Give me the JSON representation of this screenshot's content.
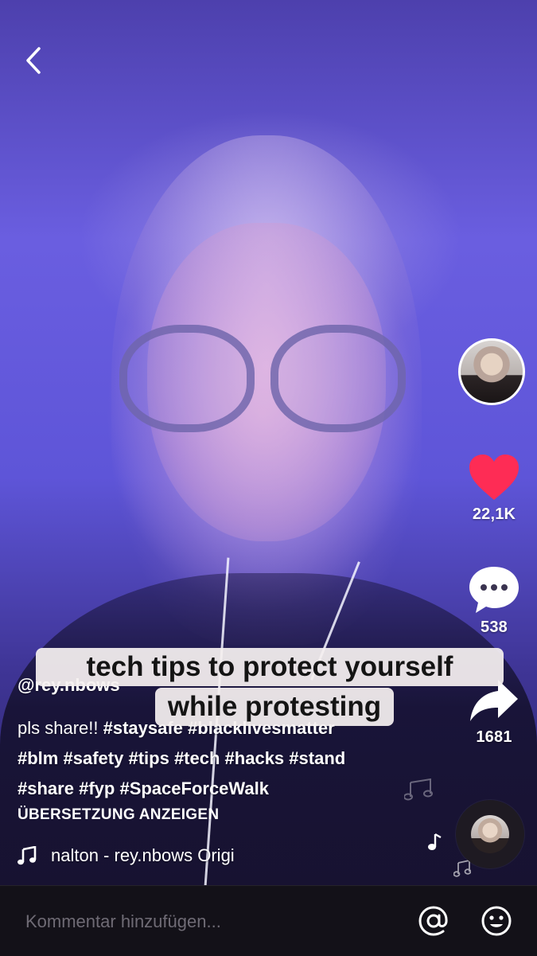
{
  "nav": {
    "back_icon": "chevron-left-icon"
  },
  "creator": {
    "avatar_icon": "creator-avatar"
  },
  "actions": {
    "likes": "22,1K",
    "comments": "538",
    "shares": "1681",
    "like_color": "#fe2c55"
  },
  "overlay_caption": {
    "line1": "tech tips to protect yourself",
    "line2": "while protesting"
  },
  "post": {
    "username": "@rey.nbows",
    "description_prefix": "pls share!! ",
    "hashtags_line1": [
      "#staysafe",
      "#blacklivesmatter"
    ],
    "hashtags_line2": [
      "#blm",
      "#safety",
      "#tips",
      "#tech",
      "#hacks",
      "#stand"
    ],
    "hashtags_line3": [
      "#share",
      "#fyp",
      "#SpaceForceWalk"
    ],
    "translate_label": "ÜBERSETZUNG ANZEIGEN",
    "music_text": "nalton - rey.nbows    Origi"
  },
  "comment_bar": {
    "placeholder": "Kommentar hinzufügen...",
    "mention_icon": "at-icon",
    "emoji_icon": "emoji-icon"
  }
}
